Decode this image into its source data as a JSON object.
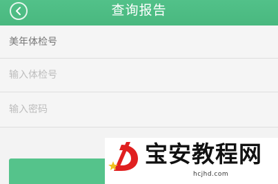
{
  "header": {
    "title": "查询报告",
    "back_icon": "chevron-left-icon",
    "background": "#4fbf86"
  },
  "form": {
    "report_type": "美年体检号",
    "exam_number_placeholder": "输入体检号",
    "password_placeholder": "输入密码"
  },
  "submit": {
    "color": "#55c38b"
  },
  "watermark": {
    "title": "宝安教程网",
    "url": "hcjhd.com"
  }
}
